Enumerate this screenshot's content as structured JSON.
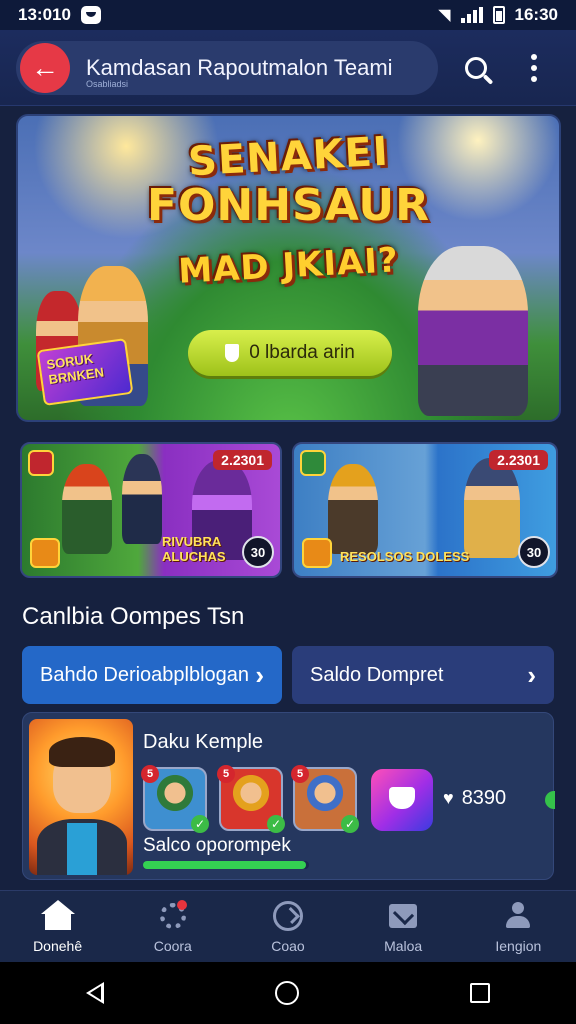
{
  "status_bar": {
    "time_left": "13:010",
    "time_right": "16:30"
  },
  "header": {
    "title": "Kamdasan Rapoutmalon Teami",
    "subtitle": "Osabliadsi",
    "icons": [
      "back-arrow-icon",
      "search-icon",
      "more-vertical-icon"
    ]
  },
  "hero": {
    "line1": "SENAKEI",
    "line2": "FONHSAUR",
    "line3": "MAD JKIAI?",
    "button_label": "0 lbarda arin",
    "badge_text": "SORUK BRNKEN"
  },
  "promos": [
    {
      "price": "2.2301",
      "count": "30",
      "caption": "RIVUBRA ALUCHAS"
    },
    {
      "price": "2.2301",
      "count": "30",
      "caption": "RESOLSOS DOLESS"
    }
  ],
  "section": {
    "title": "Canlbia Oompes Tsn"
  },
  "wallet": {
    "primary_label": "Bahdo Derioabplblogan",
    "secondary_label": "Saldo Dompret"
  },
  "profile": {
    "name": "Daku Kemple",
    "friends": [
      {
        "badge": "5",
        "check": "✓"
      },
      {
        "badge": "5",
        "check": "✓"
      },
      {
        "badge": "5",
        "check": "✓"
      }
    ],
    "coins": "8390",
    "progress_label": "Salco oporompek",
    "progress_value": 0.98
  },
  "bottom_nav": [
    {
      "label": "Donehê",
      "icon": "home-icon",
      "active": true
    },
    {
      "label": "Coora",
      "icon": "gear-icon",
      "active": false
    },
    {
      "label": "Coao",
      "icon": "clock-icon",
      "active": false
    },
    {
      "label": "Maloa",
      "icon": "mail-icon",
      "active": false
    },
    {
      "label": "Iengion",
      "icon": "user-icon",
      "active": false
    }
  ],
  "colors": {
    "background": "#16213f",
    "accent_red": "#e63946",
    "primary_blue": "#2468c8",
    "success_green": "#34d152",
    "hero_button": "#b8d832"
  }
}
